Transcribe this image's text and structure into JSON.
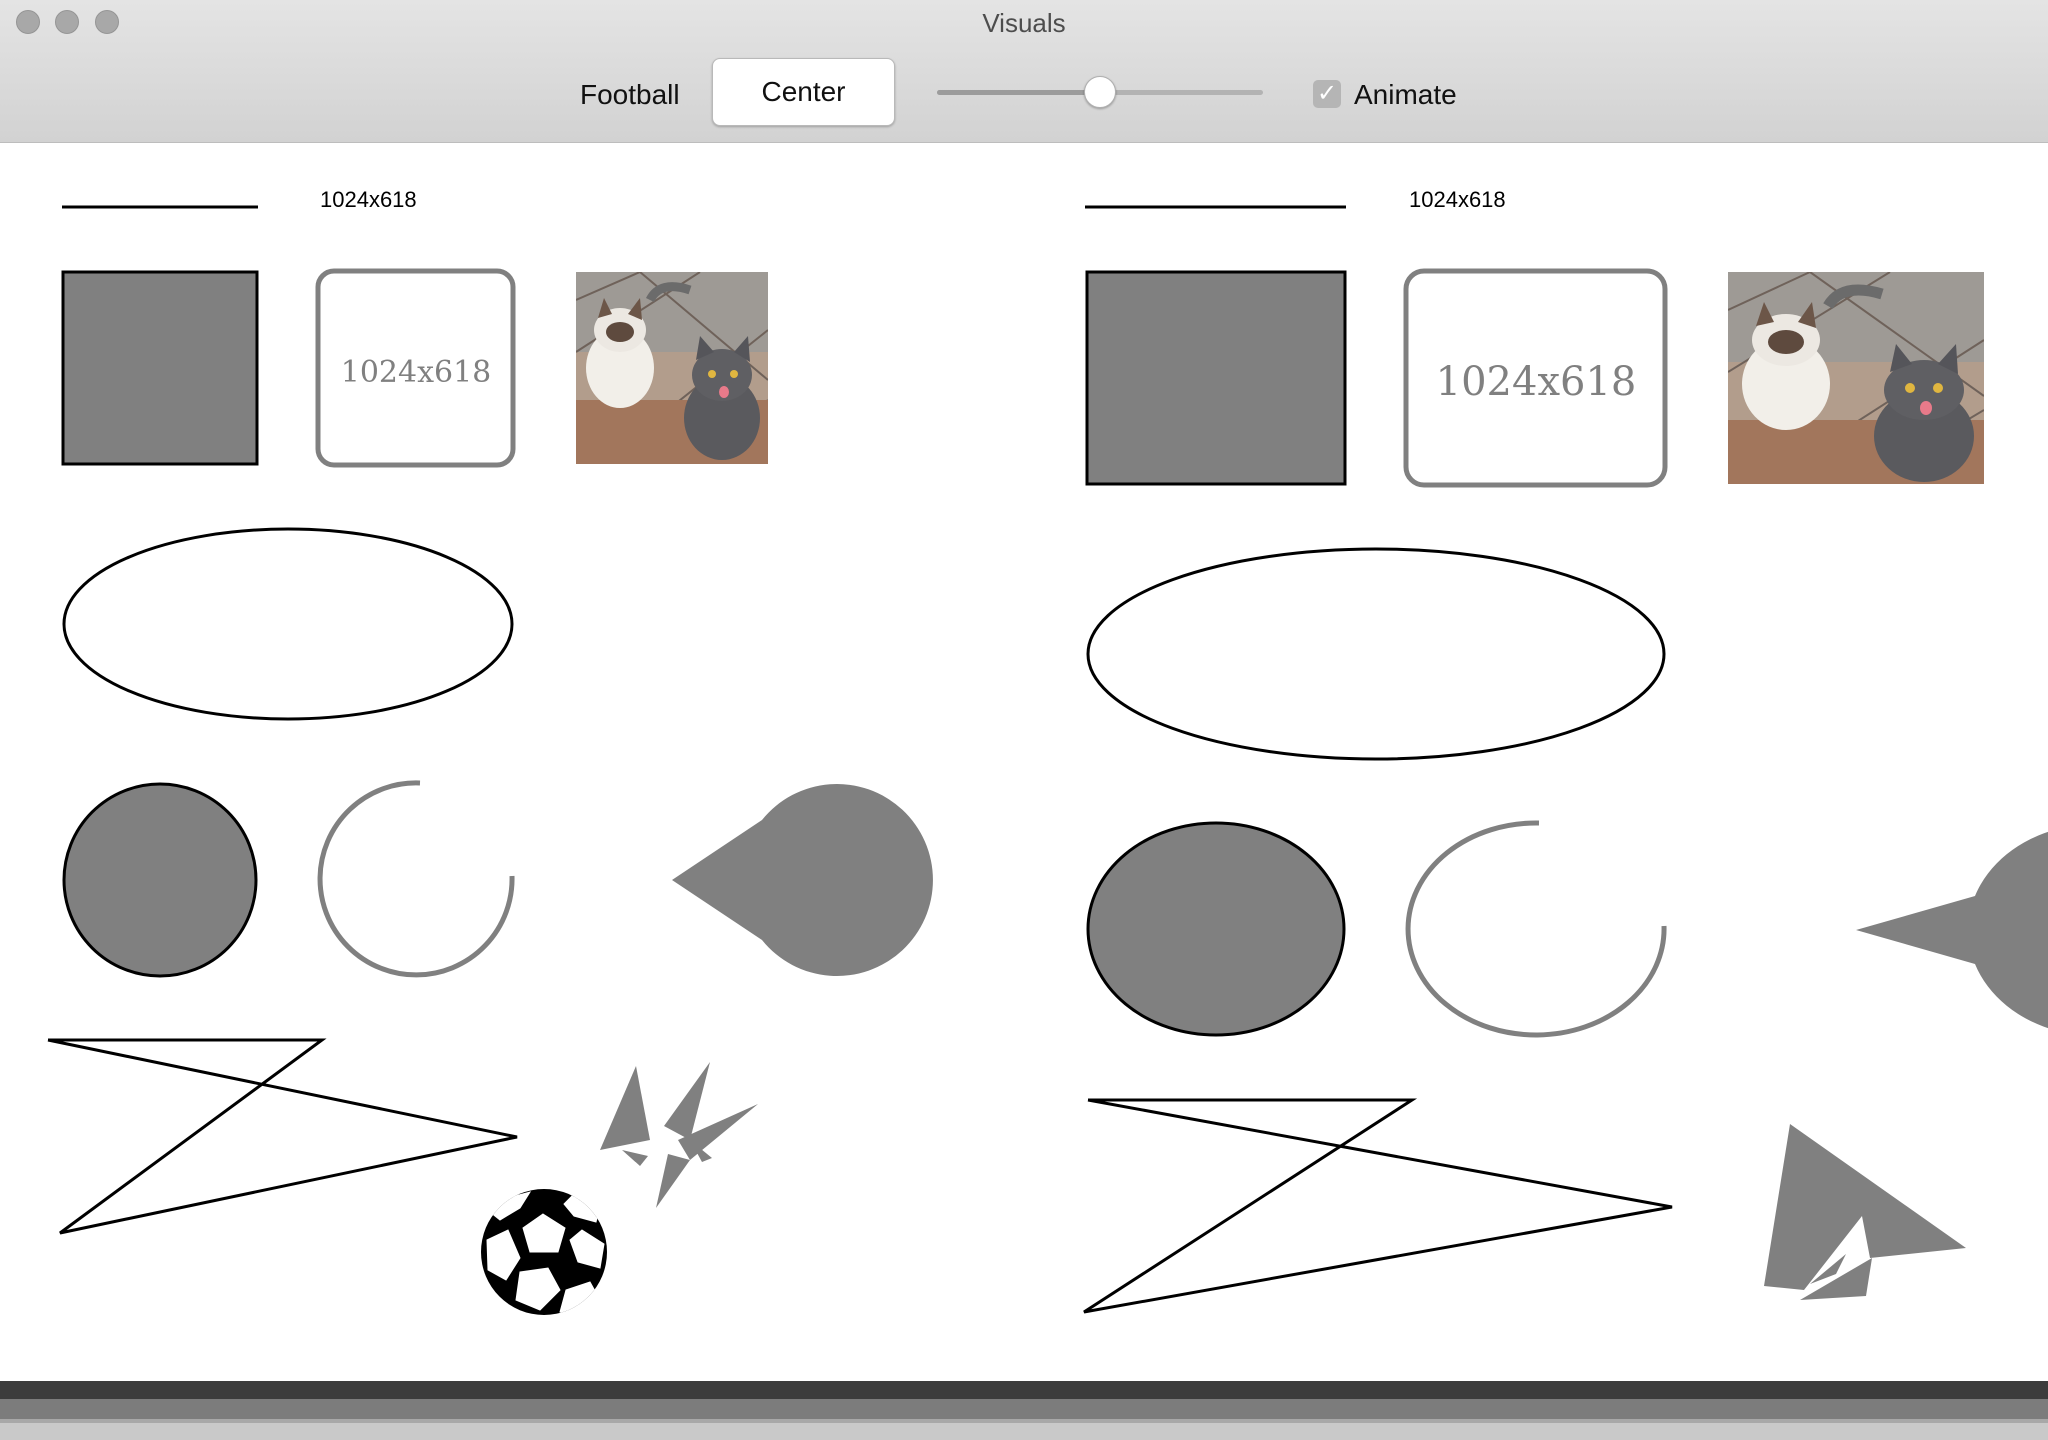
{
  "window": {
    "title": "Visuals"
  },
  "toolbar": {
    "football_label": "Football",
    "center_button_label": "Center",
    "slider_value": 0.5,
    "animate_label": "Animate",
    "animate_checked": true,
    "checkmark": "✓"
  },
  "panels": {
    "left": {
      "size_text": "1024x618",
      "rounded_box_text": "1024x618"
    },
    "right": {
      "size_text": "1024x618",
      "rounded_box_text": "1024x618"
    }
  },
  "icons": [
    "cat-photo",
    "soccer-ball-icon",
    "pacman-shape"
  ],
  "colors": {
    "shape_fill": "#808080",
    "stroke": "#000000",
    "footer_stripes": [
      "#3c3c3c",
      "#7c7c7c",
      "#a8a8a8",
      "#c9c9c9"
    ]
  }
}
